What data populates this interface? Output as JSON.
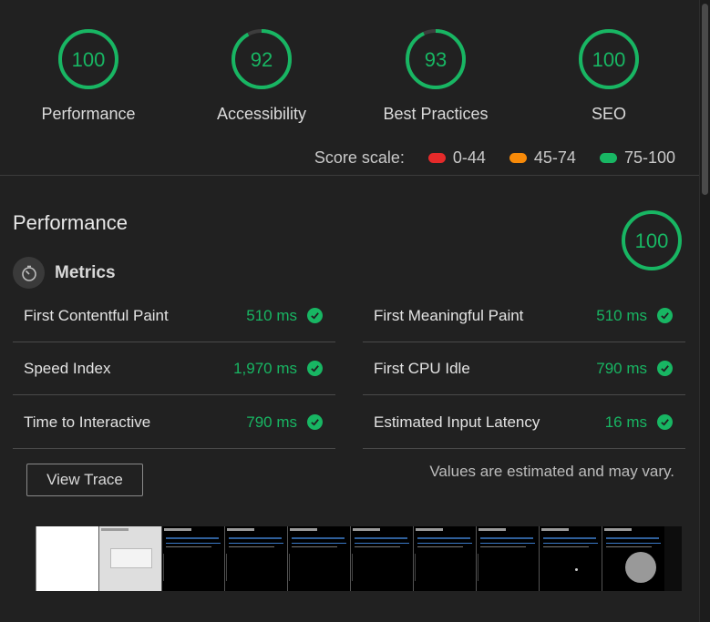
{
  "summary": {
    "gauges": [
      {
        "score": "100",
        "label": "Performance",
        "fraction": 1.0
      },
      {
        "score": "92",
        "label": "Accessibility",
        "fraction": 0.92
      },
      {
        "score": "93",
        "label": "Best Practices",
        "fraction": 0.93
      },
      {
        "score": "100",
        "label": "SEO",
        "fraction": 1.0
      }
    ],
    "scale": {
      "label": "Score scale:",
      "ranges": [
        {
          "range": "0-44",
          "color": "#e52a2a"
        },
        {
          "range": "45-74",
          "color": "#f78a09"
        },
        {
          "range": "75-100",
          "color": "#18b663"
        }
      ]
    }
  },
  "performance": {
    "title": "Performance",
    "score": "100",
    "metrics_title": "Metrics",
    "metrics": [
      {
        "name": "First Contentful Paint",
        "value": "510 ms"
      },
      {
        "name": "First Meaningful Paint",
        "value": "510 ms"
      },
      {
        "name": "Speed Index",
        "value": "1,970 ms"
      },
      {
        "name": "First CPU Idle",
        "value": "790 ms"
      },
      {
        "name": "Time to Interactive",
        "value": "790 ms"
      },
      {
        "name": "Estimated Input Latency",
        "value": "16 ms"
      }
    ],
    "view_trace_label": "View Trace",
    "note": "Values are estimated and may vary."
  },
  "colors": {
    "pass": "#18b663",
    "gauge_track": "#3d3d3d",
    "background": "#212121"
  }
}
